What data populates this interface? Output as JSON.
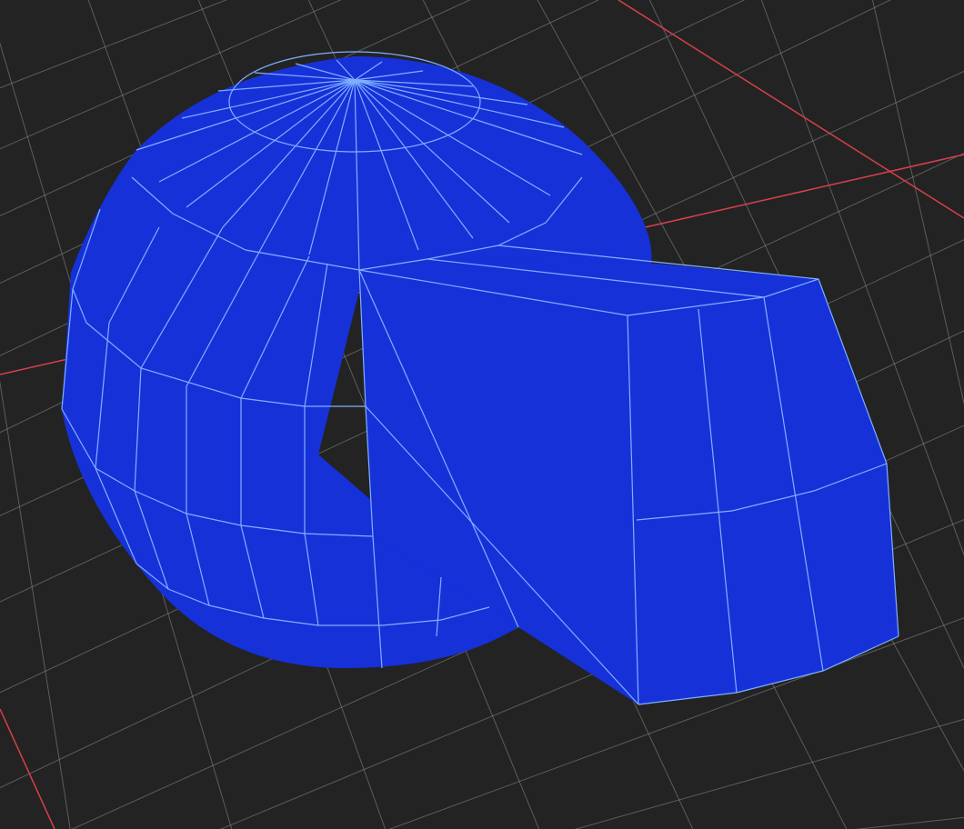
{
  "viewport": {
    "background_color": "#232323",
    "grid_color": "#8c8c8c",
    "axis_color": "#d8404a",
    "mesh_fill_color": "#1731d9",
    "mesh_wire_color": "#7fb0ff"
  },
  "scene": {
    "objects": [
      {
        "name": "dome",
        "shape": "half-sphere",
        "material_color": "#1731d9",
        "wireframe": true
      },
      {
        "name": "cylinder-block",
        "shape": "rounded-box",
        "material_color": "#1731d9",
        "wireframe": true
      }
    ],
    "grid_visible": true,
    "axes_visible": true
  }
}
